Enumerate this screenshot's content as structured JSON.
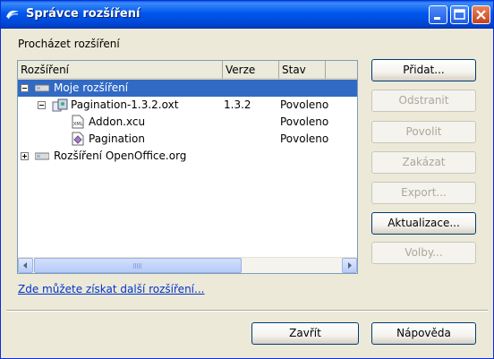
{
  "window": {
    "title": "Správce rozšíření",
    "controls": {
      "minimize": "minimize-icon",
      "maximize": "maximize-icon",
      "close": "close-icon"
    }
  },
  "section_label": "Procházet rozšíření",
  "columns": [
    "Rozšíření",
    "Verze",
    "Stav"
  ],
  "tree": {
    "rows": [
      {
        "name": "Moje rozšíření",
        "version": "",
        "status": "",
        "icon": "extension-folder-icon",
        "expander": "collapse",
        "selected": true
      },
      {
        "name": "Pagination-1.3.2.oxt",
        "version": "1.3.2",
        "status": "Povoleno",
        "icon": "package-icon",
        "expander": "collapse",
        "selected": false
      },
      {
        "name": "Addon.xcu",
        "version": "",
        "status": "Povoleno",
        "icon": "xml-file-icon",
        "expander": "",
        "selected": false
      },
      {
        "name": "Pagination",
        "version": "",
        "status": "Povoleno",
        "icon": "component-icon",
        "expander": "",
        "selected": false
      },
      {
        "name": "Rozšíření OpenOffice.org",
        "version": "",
        "status": "",
        "icon": "extension-folder-icon",
        "expander": "expand",
        "selected": false
      }
    ]
  },
  "buttons": {
    "add": "Přidat...",
    "remove": "Odstranit",
    "enable": "Povolit",
    "disable": "Zakázat",
    "export": "Export...",
    "update": "Aktualizace...",
    "options": "Volby..."
  },
  "button_states": {
    "add": "enabled",
    "remove": "disabled",
    "enable": "disabled",
    "disable": "disabled",
    "export": "disabled",
    "update": "enabled",
    "options": "disabled"
  },
  "link_text": "Zde můžete získat další rozšíření...",
  "footer": {
    "close": "Zavřít",
    "help": "Nápověda"
  },
  "colors": {
    "title_bar": "#0058ee",
    "selection": "#316ac5",
    "link": "#0033cc",
    "dialog_bg": "#ece9d8"
  }
}
